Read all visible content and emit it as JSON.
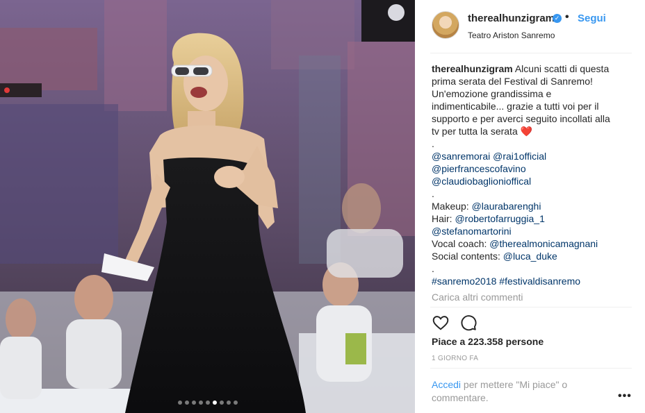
{
  "post": {
    "username": "therealhunzigram",
    "separator": "•",
    "follow_label": "Segui",
    "location": "Teatro Ariston Sanremo",
    "caption_lines": [
      "Alcuni scatti di questa",
      "prima serata del Festival di Sanremo!",
      "Un'emozione grandissima e",
      "indimenticabile... grazie a tutti voi per il",
      "supporto e per averci seguito incollati alla",
      "tv per tutta la serata"
    ],
    "heart_emoji": "❤️",
    "dot1": ".",
    "mention_sanremorai": "@sanremorai",
    "mention_rai1": "@rai1official",
    "mention_favino": "@pierfrancescofavino",
    "mention_baglioni": "@claudiobaglionioffical",
    "dot2": ".",
    "makeup_label": "Makeup:",
    "makeup_mention": "@laurabarenghi",
    "hair_label": "Hair:",
    "hair_mention": "@robertofarruggia_1",
    "hair_mention2": "@stefanomartorini",
    "vocal_label": "Vocal coach:",
    "vocal_mention": "@therealmonicamagnani",
    "social_label": "Social contents:",
    "social_mention": "@luca_duke",
    "dot3": ".",
    "hashtag1": "#sanremo2018",
    "hashtag2": "#festivaldisanremo",
    "load_more": "Carica altri commenti",
    "likes": "Piace a 223.358 persone",
    "date": "1 GIORNO FA",
    "login_link": "Accedi",
    "login_text": " per mettere \"Mi piace\" o commentare.",
    "more_label": "•••"
  },
  "carousel": {
    "count": 9,
    "active_index": 5
  },
  "icons": {
    "like": "heart-outline-icon",
    "comment": "comment-bubble-icon",
    "verified": "verified-badge-icon"
  },
  "colors": {
    "accent": "#3897f0",
    "link": "#003569",
    "muted": "#999999"
  }
}
